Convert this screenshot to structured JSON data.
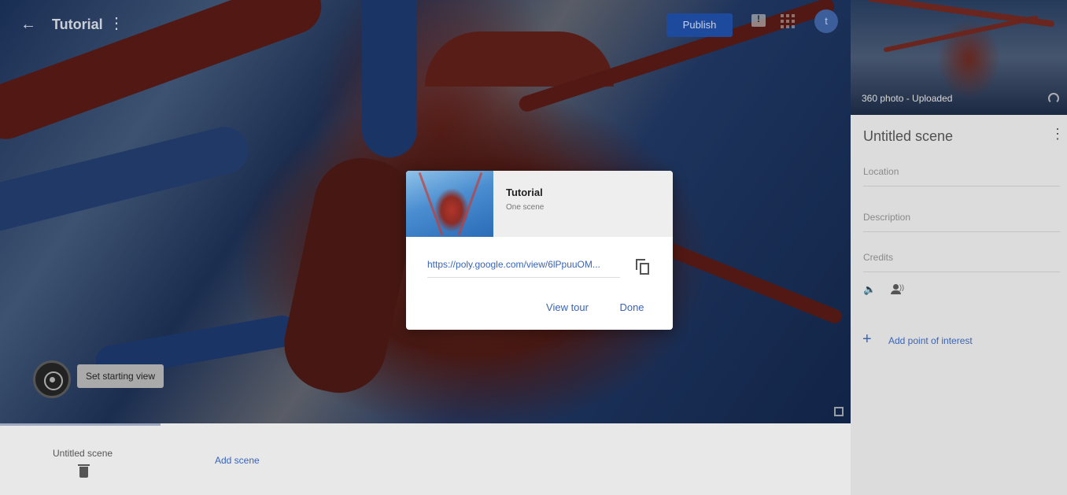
{
  "topbar": {
    "back_icon": "arrow-back-icon",
    "title": "Tutorial",
    "title_menu_icon": "more-vert-icon",
    "publish_label": "Publish",
    "feedback_icon": "feedback-icon",
    "apps_icon": "apps-grid-icon",
    "avatar_letter": "t"
  },
  "viewer": {
    "set_starting_view_label": "Set starting view",
    "starting_view_icon": "compass-icon",
    "fullscreen_icon": "fullscreen-icon"
  },
  "scene_strip": {
    "scenes": [
      {
        "name": "Untitled scene",
        "delete_icon": "trash-icon"
      }
    ],
    "add_scene_label": "Add scene"
  },
  "panel": {
    "photo_caption": "360 photo - Uploaded",
    "replace_icon": "replace-photo-icon",
    "scene_title": "Untitled scene",
    "menu_icon": "more-vert-icon",
    "fields": {
      "location": "Location",
      "description": "Description",
      "credits": "Credits"
    },
    "audio_icon": "volume-icon",
    "narration_icon": "narration-icon",
    "add_poi_label": "Add point of interest"
  },
  "dialog": {
    "title": "Tutorial",
    "subtitle": "One scene",
    "link": "https://poly.google.com/view/6lPpuuOM...",
    "copy_icon": "copy-icon",
    "view_tour_label": "View tour",
    "done_label": "Done"
  },
  "colors": {
    "accent": "#3a64b6",
    "publish_button": "#1e4a9e",
    "panel_bg": "#dcdcdc",
    "dialog_header_bg": "#eeeeee"
  }
}
